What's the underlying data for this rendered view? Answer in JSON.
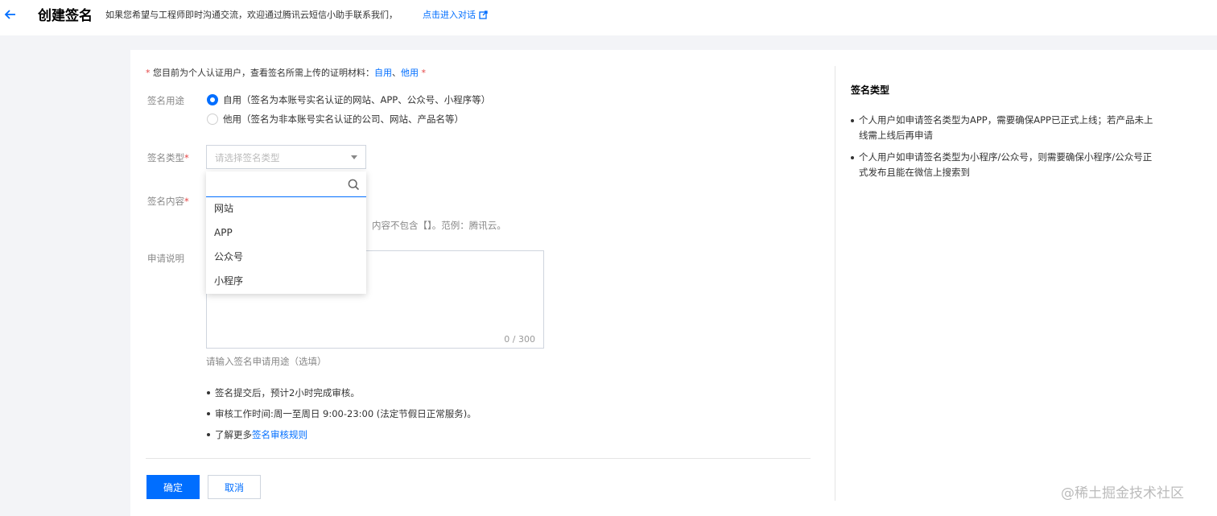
{
  "header": {
    "title": "创建签名",
    "notice": "如果您希望与工程师即时沟通交流，欢迎通过腾讯云短信小助手联系我们，",
    "notice_link": "点击进入对话"
  },
  "form": {
    "tip": {
      "prefix": "您目前为个人认证用户，查看签名所需上传的证明材料：",
      "link1": "自用",
      "sep": "、",
      "link2": "他用"
    },
    "usage": {
      "label": "签名用途",
      "options": [
        {
          "label": "自用（签名为本账号实名认证的网站、APP、公众号、小程序等）",
          "selected": true
        },
        {
          "label": "他用（签名为非本账号实名认证的公司、网站、产品名等）",
          "selected": false
        }
      ]
    },
    "type": {
      "label": "签名类型",
      "placeholder": "请选择签名类型",
      "search_value": "",
      "options": [
        "网站",
        "APP",
        "公众号",
        "小程序"
      ]
    },
    "content": {
      "label": "签名内容",
      "hint_fragment": "内容不包含【】。范例：腾讯云。"
    },
    "description": {
      "label": "申请说明",
      "value": "",
      "counter": "0 / 300",
      "hint": "请输入签名申请用途（选填）"
    },
    "notes": {
      "item1": "签名提交后，预计2小时完成审核。",
      "item2": "审核工作时间:周一至周日 9:00-23:00 (法定节假日正常服务)。",
      "item3_prefix": "了解更多",
      "item3_link": "签名审核规则"
    },
    "buttons": {
      "confirm": "确定",
      "cancel": "取消"
    }
  },
  "sidebar": {
    "title": "签名类型",
    "items": [
      "个人用户如申请签名类型为APP，需要确保APP已正式上线；若产品未上线需上线后再申请",
      "个人用户如申请签名类型为小程序/公众号，则需要确保小程序/公众号正式发布且能在微信上搜索到"
    ]
  },
  "watermark": "@稀土掘金技术社区",
  "colors": {
    "accent": "#006eff",
    "required": "#e54545",
    "muted": "#888888"
  }
}
